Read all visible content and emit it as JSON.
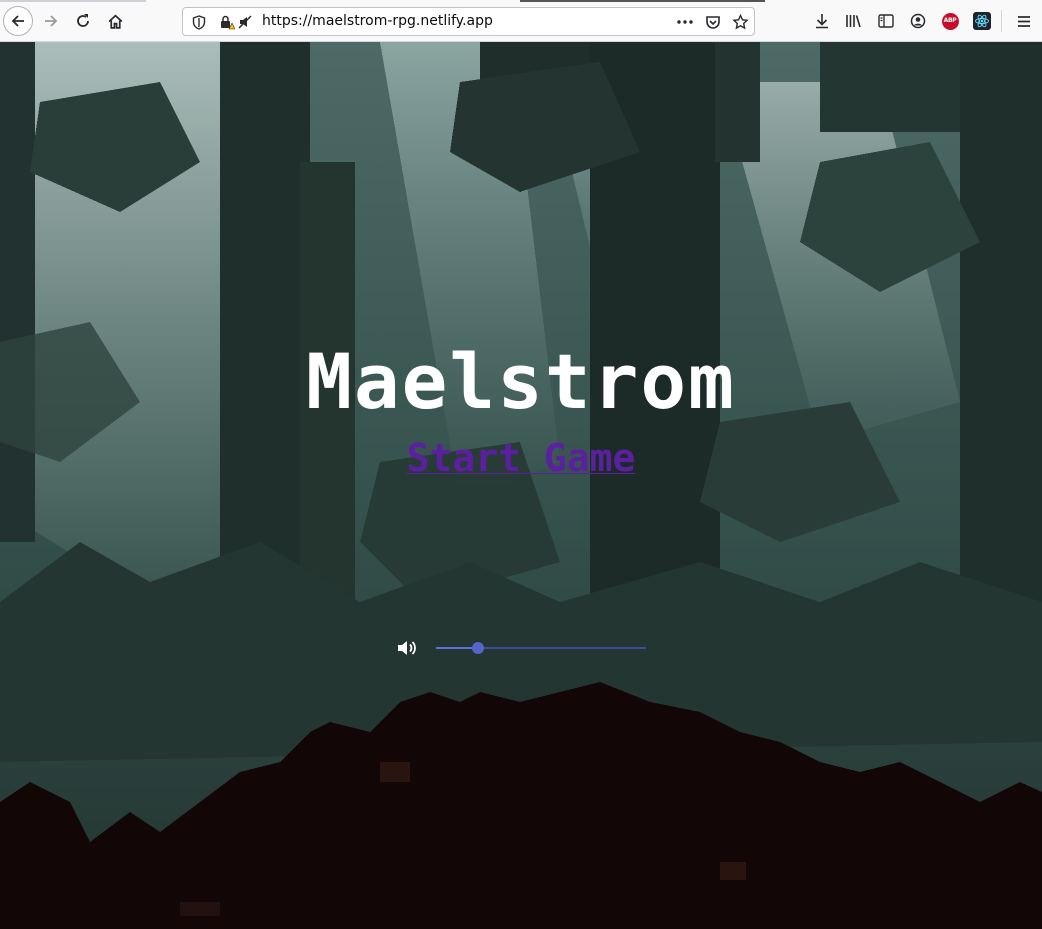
{
  "browser": {
    "url": "https://maelstrom-rpg.netlify.app",
    "extensions": {
      "adblock_label": "ABP"
    },
    "icons": [
      "back-arrow-icon",
      "forward-arrow-icon",
      "reload-icon",
      "home-icon",
      "shield-icon",
      "insecure-lock-warning-icon",
      "autoplay-blocked-icon",
      "more-dots-icon",
      "pocket-icon",
      "bookmark-star-icon",
      "download-icon",
      "library-icon",
      "sidebar-icon",
      "account-icon",
      "adblock-plus-icon",
      "react-devtools-icon",
      "hamburger-menu-icon"
    ]
  },
  "game": {
    "title": "Maelstrom",
    "start_label": "Start Game",
    "volume": {
      "icon": "speaker-icon",
      "level": 0.2
    }
  },
  "colors": {
    "title": "#ffffff",
    "start_link": "#5b1fa0",
    "slider": "#5466c8",
    "forest_dark": "#1d2b29",
    "ground": "#120607"
  }
}
